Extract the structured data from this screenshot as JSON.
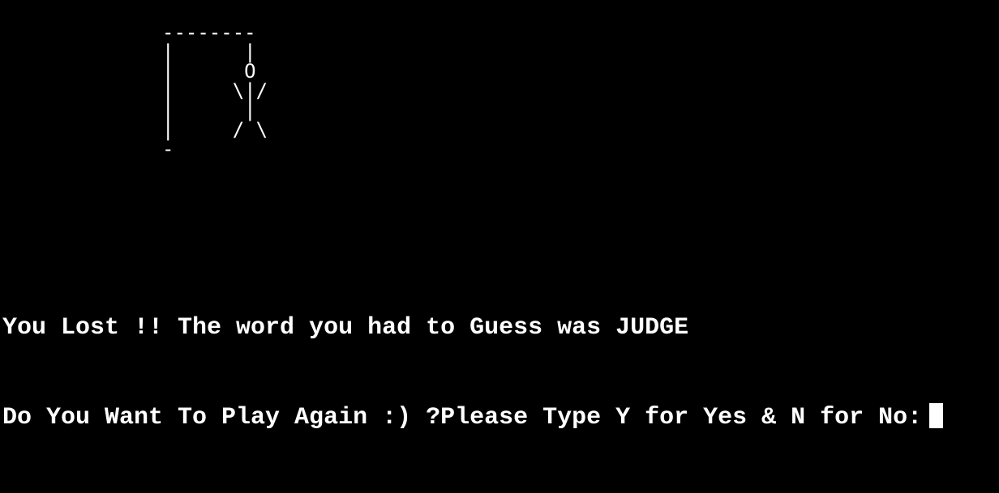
{
  "terminal": {
    "background": "#000000",
    "foreground": "#ffffff",
    "hangman_art": [
      "--------",
      "|      |",
      "|      O",
      "|     \\|/",
      "|      |",
      "|     / \\",
      "-"
    ],
    "lost_message": "You Lost !! The word you had to Guess was JUDGE",
    "prompt": "Do You Want To Play Again :) ?Please Type Y for Yes & N for No:",
    "input_value": ""
  }
}
